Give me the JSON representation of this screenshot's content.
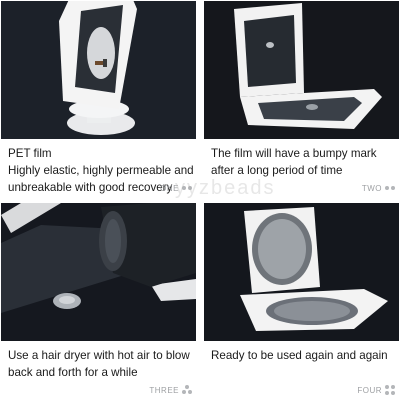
{
  "panels": [
    {
      "lines": [
        "PET film",
        "Highly elastic, highly permeable and",
        "unbreakable with good recovery"
      ],
      "tag": "ONE"
    },
    {
      "lines": [
        "The film will have a bumpy mark",
        "after a long period of time"
      ],
      "tag": "TWO"
    },
    {
      "lines": [
        "Use a hair dryer with hot air to blow",
        "back and forth for a while"
      ],
      "tag": "THREE"
    },
    {
      "lines": [
        "Ready to be used again and again"
      ],
      "tag": "FOUR"
    }
  ],
  "watermark": "yyzbeads"
}
